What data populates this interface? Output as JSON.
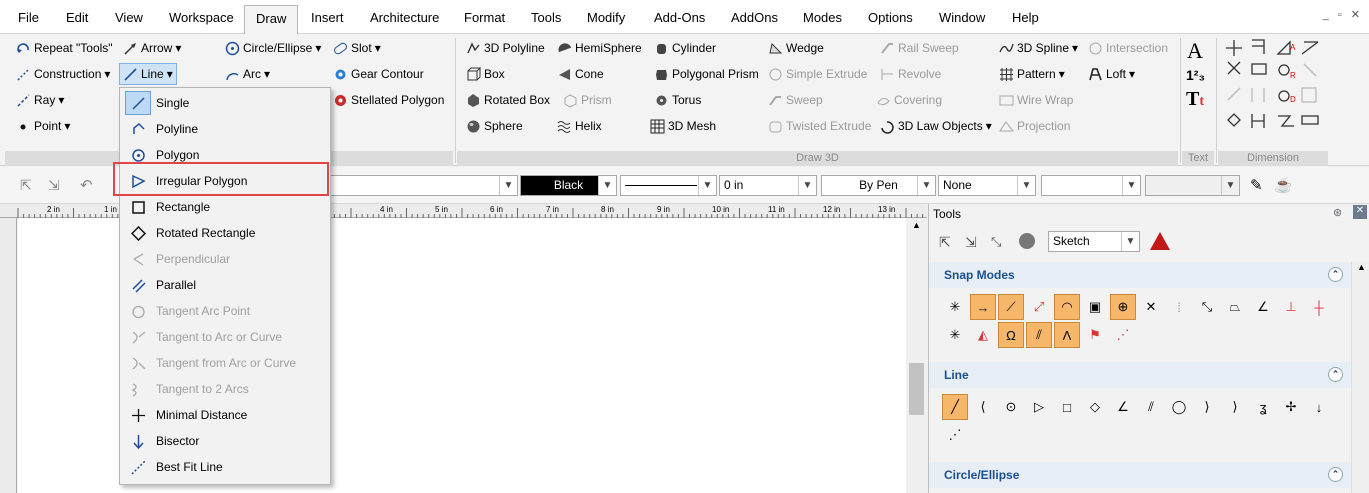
{
  "menu": [
    "File",
    "Edit",
    "View",
    "Workspace",
    "Draw",
    "Insert",
    "Architecture",
    "Format",
    "Tools",
    "Modify",
    "Add-Ons",
    "AddOns",
    "Modes",
    "Options",
    "Window",
    "Help"
  ],
  "window_controls": "_ ▫ ✕",
  "ribbon": {
    "sketch": {
      "repeat": "Repeat \"Tools\"",
      "arrow": "Arrow",
      "circle": "Circle/Ellipse",
      "slot": "Slot",
      "construction": "Construction",
      "line": "Line",
      "arc": "Arc",
      "gear": "Gear Contour",
      "ray": "Ray",
      "stellated": "Stellated Polygon",
      "point": "Point"
    },
    "draw3d": {
      "label": "Draw 3D",
      "polyline3d": "3D Polyline",
      "hemisphere": "HemiSphere",
      "cylinder": "Cylinder",
      "wedge": "Wedge",
      "railsweep": "Rail Sweep",
      "spline3d": "3D Spline",
      "intersection": "Intersection",
      "box": "Box",
      "cone": "Cone",
      "prism_poly": "Polygonal Prism",
      "simple_extrude": "Simple Extrude",
      "revolve": "Revolve",
      "pattern": "Pattern",
      "loft": "Loft",
      "rotated_box": "Rotated Box",
      "prism": "Prism",
      "torus": "Torus",
      "sweep": "Sweep",
      "covering": "Covering",
      "wirewrap": "Wire Wrap",
      "sphere": "Sphere",
      "helix": "Helix",
      "mesh3d": "3D Mesh",
      "twisted": "Twisted Extrude",
      "lawobj": "3D Law Objects",
      "projection": "Projection"
    },
    "text_label": "Text",
    "dim_label": "Dimension"
  },
  "toolbar2": {
    "color": "Black",
    "thickness": "0 in",
    "pen": "By Pen",
    "arrows": "None"
  },
  "ruler": [
    "2 in",
    "1 in",
    "",
    "4 in",
    "5 in",
    "6 in",
    "7 in",
    "8 in",
    "9 in",
    "10 in",
    "11 in",
    "12 in",
    "13 in"
  ],
  "dropdown": [
    {
      "label": "Single",
      "state": "sel"
    },
    {
      "label": "Polyline",
      "state": ""
    },
    {
      "label": "Polygon",
      "state": ""
    },
    {
      "label": "Irregular Polygon",
      "state": ""
    },
    {
      "label": "Rectangle",
      "state": ""
    },
    {
      "label": "Rotated Rectangle",
      "state": ""
    },
    {
      "label": "Perpendicular",
      "state": "dis"
    },
    {
      "label": "Parallel",
      "state": ""
    },
    {
      "label": "Tangent Arc Point",
      "state": "dis"
    },
    {
      "label": "Tangent to Arc or Curve",
      "state": "dis"
    },
    {
      "label": "Tangent from Arc or Curve",
      "state": "dis"
    },
    {
      "label": "Tangent to 2 Arcs",
      "state": "dis"
    },
    {
      "label": "Minimal Distance",
      "state": ""
    },
    {
      "label": "Bisector",
      "state": ""
    },
    {
      "label": "Best Fit Line",
      "state": ""
    }
  ],
  "tools": {
    "title": "Tools",
    "mode": "Sketch",
    "snap": "Snap Modes",
    "line": "Line",
    "circle": "Circle/Ellipse"
  }
}
